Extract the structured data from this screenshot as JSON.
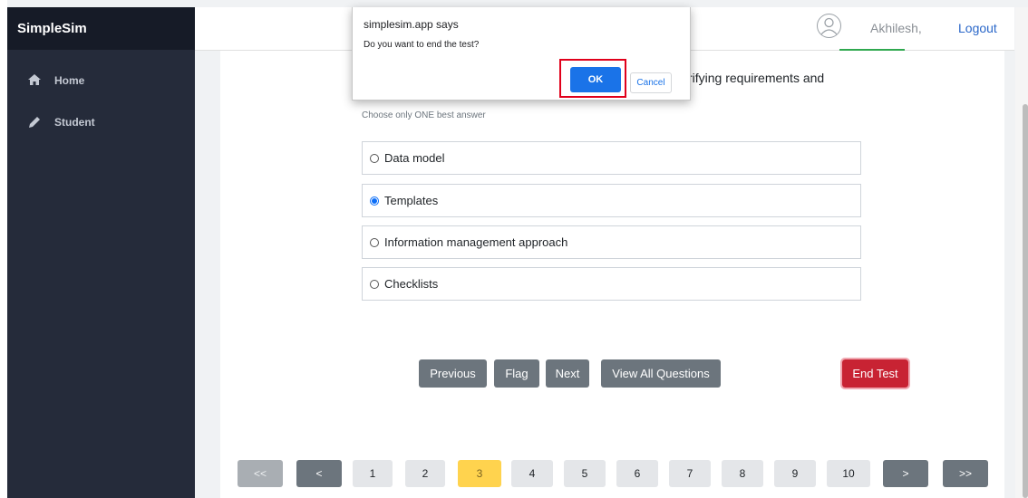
{
  "app": {
    "title": "SimpleSim"
  },
  "sidebar": {
    "items": [
      {
        "label": "Home",
        "icon": "home-icon"
      },
      {
        "label": "Student",
        "icon": "pencil-icon"
      }
    ]
  },
  "header": {
    "username": "Akhilesh,",
    "logout": "Logout",
    "avatar_icon": "user-avatar-icon"
  },
  "question": {
    "text_fragment": "rifying requirements and",
    "instruction": "Choose only ONE best answer"
  },
  "options": [
    {
      "label": "Data model",
      "selected": false
    },
    {
      "label": "Templates",
      "selected": true
    },
    {
      "label": "Information management approach",
      "selected": false
    },
    {
      "label": "Checklists",
      "selected": false
    }
  ],
  "buttons": {
    "previous": "Previous",
    "flag": "Flag",
    "next": "Next",
    "view_all": "View All Questions",
    "end_test": "End Test"
  },
  "pagination": {
    "first": "<<",
    "prev": "<",
    "pages": [
      "1",
      "2",
      "3",
      "4",
      "5",
      "6",
      "7",
      "8",
      "9",
      "10"
    ],
    "current": "3",
    "next": ">",
    "last": ">>"
  },
  "dialog": {
    "title": "simplesim.app says",
    "message": "Do you want to end the test?",
    "ok": "OK",
    "cancel": "Cancel"
  },
  "colors": {
    "sidebar": "#252b3a",
    "primary": "#1a73e8",
    "end_test": "#c82333",
    "current_page": "#ffd34e",
    "highlight": "#e0001b"
  }
}
